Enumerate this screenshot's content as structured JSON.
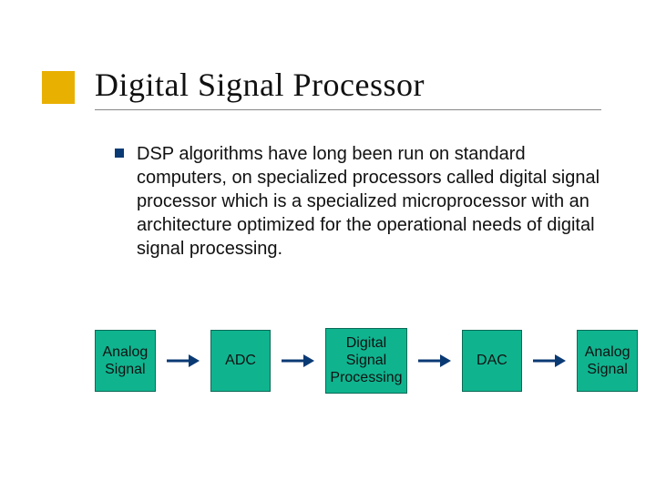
{
  "title": "Digital Signal Processor",
  "body": {
    "bullet1": "DSP algorithms have long been run on standard computers, on specialized processors called digital signal processor which is a specialized microprocessor with an architecture optimized for the operational needs of digital signal processing."
  },
  "flow": {
    "boxes": [
      "Analog Signal",
      "ADC",
      "Digital Signal Processing",
      "DAC",
      "Analog Signal"
    ]
  },
  "colors": {
    "accent": "#e8b000",
    "bullet": "#0a3a74",
    "box_fill": "#0fb48f",
    "arrow": "#0a3a74"
  }
}
